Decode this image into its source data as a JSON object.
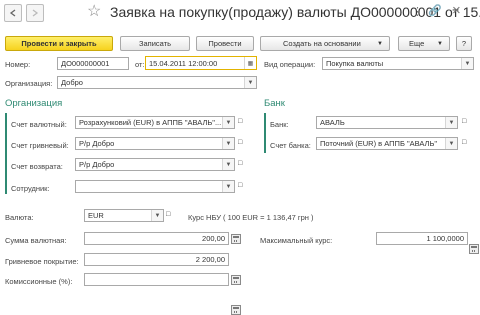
{
  "window": {
    "title": "Заявка на покупку(продажу) валюты ДО000000001 от 15...."
  },
  "toolbar": {
    "post_close": "Провести и закрыть",
    "save": "Записать",
    "post": "Провести",
    "create_based": "Создать на основании",
    "more": "Еще",
    "help": "?"
  },
  "header": {
    "number_label": "Номер:",
    "number_value": "ДО000000001",
    "date_label": "от:",
    "date_value": "15.04.2011 12:00:00",
    "operation_label": "Вид операции:",
    "operation_value": "Покупка валюты",
    "org_label": "Организация:",
    "org_value": "Добро"
  },
  "org_section": {
    "title": "Организация",
    "currency_account_label": "Счет валютный:",
    "currency_account_value": "Розрахунковий (EUR) в АППБ \"АВАЛЬ\"...",
    "uah_account_label": "Счет гривневый:",
    "uah_account_value": "Р/р Добро",
    "return_account_label": "Счет возврата:",
    "return_account_value": "Р/р Добро",
    "employee_label": "Сотрудник:",
    "employee_value": ""
  },
  "bank_section": {
    "title": "Банк",
    "bank_label": "Банк:",
    "bank_value": "АВАЛЬ",
    "bank_account_label": "Счет банка:",
    "bank_account_value": "Поточний (EUR) в АППБ \"АВАЛЬ\""
  },
  "amounts": {
    "currency_label": "Валюта:",
    "currency_value": "EUR",
    "nbu_rate": "Курс НБУ  ( 100 EUR = 1 136,47 грн )",
    "currency_sum_label": "Сумма валютная:",
    "currency_sum_value": "200,00",
    "max_rate_label": "Максимальный курс:",
    "max_rate_value": "1 100,0000",
    "uah_cover_label": "Гривневое покрытие:",
    "uah_cover_value": "2 200,00",
    "commission_label": "Комиссионные (%):",
    "commission_value": ""
  },
  "icons": [
    "nav-back-icon",
    "nav-forward-icon",
    "star-icon",
    "menu-dots-icon",
    "link-icon",
    "close-icon",
    "calendar-icon",
    "calculator-icon",
    "dropdown-icon",
    "open-icon"
  ]
}
